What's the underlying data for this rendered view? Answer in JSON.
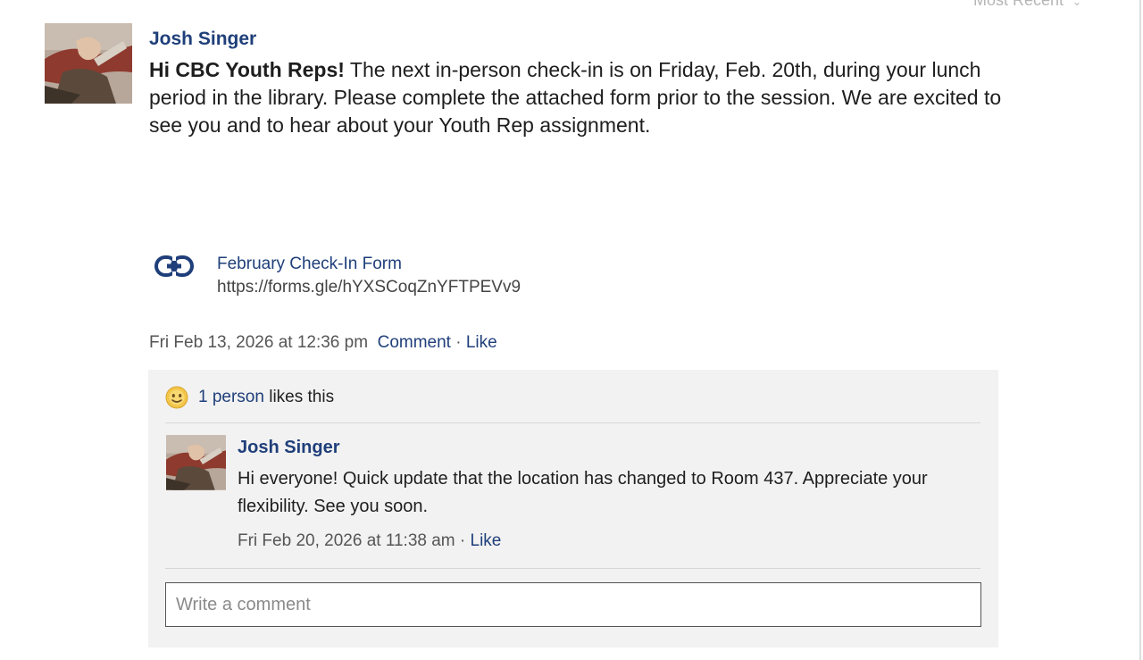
{
  "sort": {
    "label": "Most Recent",
    "icon": "chevron-down-icon"
  },
  "post": {
    "author": "Josh Singer",
    "body_bold": "Hi CBC Youth Reps!",
    "body_rest": " The next in-person check-in is on Friday, Feb. 20th, during your lunch period in the library.  Please complete the attached form prior to the session.  We are excited to see you and to hear about your Youth Rep assignment.",
    "attachment": {
      "icon": "link-icon",
      "title": "February Check-In Form",
      "url": "https://forms.gle/hYXSCoqZnYFTPEVv9"
    },
    "timestamp": "Fri Feb 13, 2026 at 12:36 pm",
    "comment_label": "Comment",
    "separator": "·",
    "like_label": "Like"
  },
  "likes": {
    "icon": "smiley-icon",
    "count_text": "1 person",
    "suffix": " likes this"
  },
  "comment": {
    "author": "Josh Singer",
    "text": "Hi everyone! Quick update that the location has changed to Room 437. Appreciate your flexibility. See you soon.",
    "timestamp": "Fri Feb 20, 2026 at 11:38 am",
    "separator": "·",
    "like_label": "Like"
  },
  "comment_input": {
    "placeholder": "Write a comment"
  },
  "colors": {
    "link": "#1f3f7a",
    "panel_bg": "#f2f2f2",
    "muted": "#555555"
  }
}
